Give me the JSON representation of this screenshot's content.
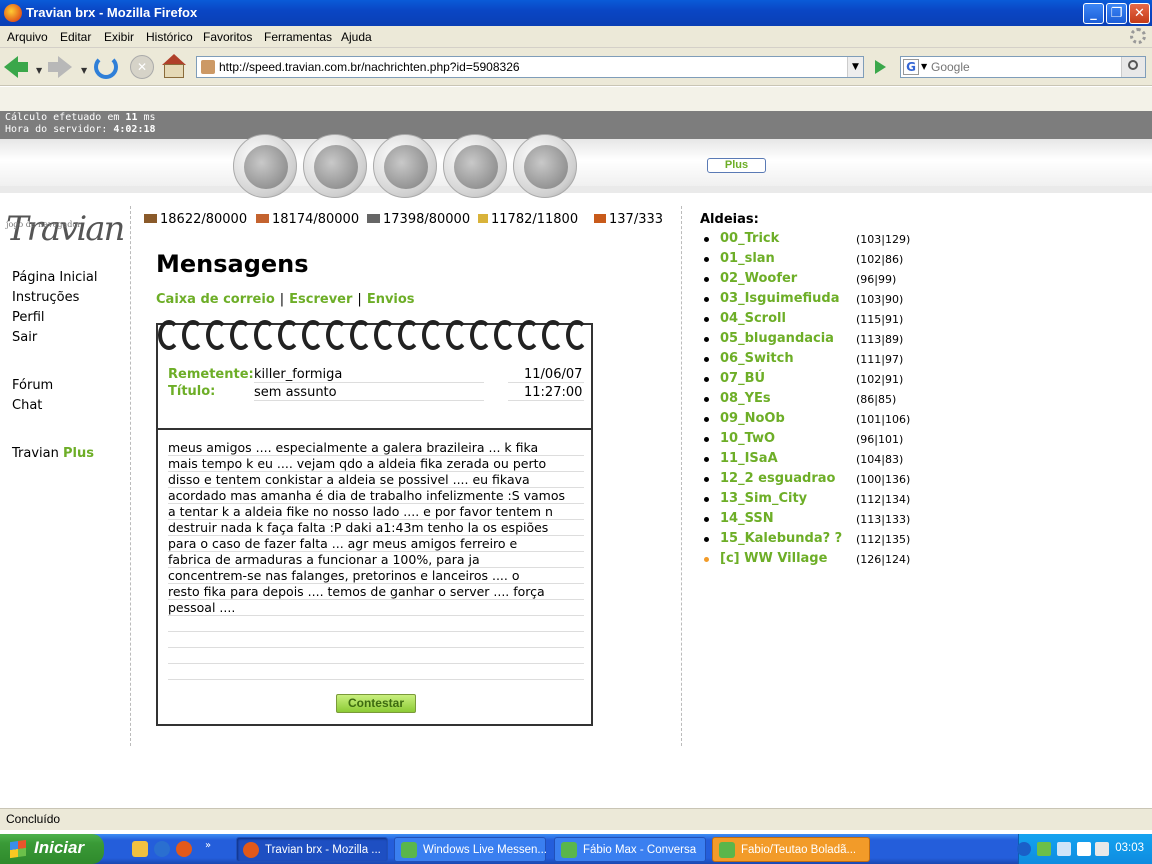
{
  "window": {
    "title": "Travian brx - Mozilla Firefox"
  },
  "menu": [
    "Arquivo",
    "Editar",
    "Exibir",
    "Histórico",
    "Favoritos",
    "Ferramentas",
    "Ajuda"
  ],
  "nav": {
    "url": "http://speed.travian.com.br/nachrichten.php?id=5908326",
    "search_placeholder": "Google",
    "search_engine_icon": "G"
  },
  "server": {
    "calc_prefix": "Cálculo efetuado em ",
    "calc_value": "11",
    "calc_suffix": " ms",
    "time_label": "Hora do servidor: ",
    "time_value": "4:02:18"
  },
  "topnav": {
    "plus_label": "Plus"
  },
  "logo": {
    "tagline": "jogo de navegador",
    "text": "Travian"
  },
  "leftnav": {
    "home": "Página Inicial",
    "instructions": "Instruções",
    "profile": "Perfil",
    "logout": "Sair",
    "forum": "Fórum",
    "chat": "Chat",
    "travian": "Travian",
    "plus": "Plus"
  },
  "resources": {
    "wood": "18622/80000",
    "clay": "18174/80000",
    "iron": "17398/80000",
    "crop": "11782/11800",
    "consumption": "137/333"
  },
  "page": {
    "title": "Mensagens",
    "links": [
      "Caixa de correio",
      "Escrever",
      "Envios"
    ]
  },
  "message": {
    "sender_label": "Remetente:",
    "sender": "killer_formiga",
    "date": "11/06/07",
    "subject_label": "Título:",
    "subject": "sem assunto",
    "time": "11:27:00",
    "body": "meus amigos .... especialmente a galera brazileira ... k fika\nmais tempo k eu .... vejam qdo a aldeia fika zerada ou perto\ndisso e tentem conkistar a aldeia se possivel .... eu fikava\nacordado mas amanha é dia de trabalho infelizmente :S vamos\na tentar k a aldeia fike no nosso lado .... e por favor tentem n\ndestruir nada k faça falta :P daki a1:43m tenho la os espiões\npara o caso de fazer falta ... agr meus amigos ferreiro e\nfabrica de armaduras a funcionar a 100%, para ja\nconcentrem-se nas falanges, pretorinos e lanceiros .... o\nresto fika para depois .... temos de ganhar o server .... força\npessoal ....",
    "reply_button": "Contestar"
  },
  "villages_title": "Aldeias:",
  "villages": [
    {
      "name": "00_Trick",
      "coord": "(103|129)"
    },
    {
      "name": "01_slan",
      "coord": "(102|86)"
    },
    {
      "name": "02_Woofer",
      "coord": "(96|99)"
    },
    {
      "name": "03_Isguimefiuda",
      "coord": "(103|90)"
    },
    {
      "name": "04_Scroll",
      "coord": "(115|91)"
    },
    {
      "name": "05_blugandacia",
      "coord": "(113|89)"
    },
    {
      "name": "06_Switch",
      "coord": "(111|97)"
    },
    {
      "name": "07_BÚ",
      "coord": "(102|91)"
    },
    {
      "name": "08_YEs",
      "coord": "(86|85)"
    },
    {
      "name": "09_NoOb",
      "coord": "(101|106)"
    },
    {
      "name": "10_TwO",
      "coord": "(96|101)"
    },
    {
      "name": "11_ISaA",
      "coord": "(104|83)"
    },
    {
      "name": "12_2 esguadrao",
      "coord": "(100|136)"
    },
    {
      "name": "13_Sim_City",
      "coord": "(112|134)"
    },
    {
      "name": "14_SSN",
      "coord": "(113|133)"
    },
    {
      "name": "15_Kalebunda? ?",
      "coord": "(112|135)"
    },
    {
      "name": "[c] WW Village",
      "coord": "(126|124)",
      "active": true
    }
  ],
  "statusbar": {
    "text": "Concluído"
  },
  "taskbar": {
    "start": "Iniciar",
    "tasks": [
      "Travian brx - Mozilla ...",
      "Windows Live Messen...",
      "Fábio Max - Conversa",
      "Fabio/Teutao Boladã..."
    ],
    "clock": "03:03"
  },
  "colors": {
    "accent_green": "#6dae27",
    "active_village_dot": "#f29b29"
  }
}
